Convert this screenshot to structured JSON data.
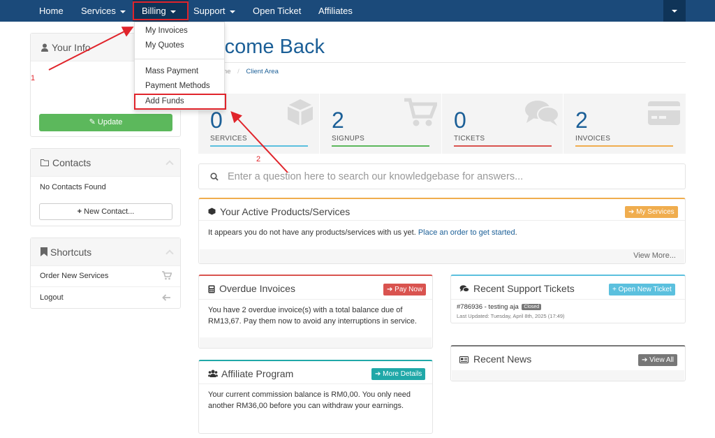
{
  "nav": {
    "items": [
      {
        "label": "Home"
      },
      {
        "label": "Services"
      },
      {
        "label": "Billing"
      },
      {
        "label": "Support"
      },
      {
        "label": "Open Ticket"
      },
      {
        "label": "Affiliates"
      }
    ]
  },
  "billing_dropdown": {
    "items": [
      "My Invoices",
      "My Quotes",
      "Mass Payment",
      "Payment Methods",
      "Add Funds"
    ]
  },
  "annotations": {
    "label1": "1",
    "label2": "2",
    "color": "#e0242b"
  },
  "sidebar": {
    "your_info": {
      "title": "Your Info",
      "update_label": "Update"
    },
    "contacts": {
      "title": "Contacts",
      "empty_text": "No Contacts Found",
      "new_contact_label": "New Contact..."
    },
    "shortcuts": {
      "title": "Shortcuts",
      "items": [
        {
          "label": "Order New Services"
        },
        {
          "label": "Logout"
        }
      ]
    }
  },
  "main": {
    "heading": "elcome Back",
    "breadcrumb": {
      "home": "ome",
      "separator": "/",
      "current": "Client Area"
    },
    "stats": [
      {
        "value": "0",
        "label": "SERVICES",
        "color": "#5bc0de"
      },
      {
        "value": "2",
        "label": "SIGNUPS",
        "color": "#5cb85c"
      },
      {
        "value": "0",
        "label": "TICKETS",
        "color": "#d9534f"
      },
      {
        "value": "2",
        "label": "INVOICES",
        "color": "#f0ad4e"
      }
    ],
    "kb_search_placeholder": "Enter a question here to search our knowledgebase for answers...",
    "active_products": {
      "title": "Your Active Products/Services",
      "button": "My Services",
      "text_prefix": "It appears you do not have any products/services with us yet.",
      "link": "Place an order to get started",
      "text_suffix": ".",
      "view_more": "View More..."
    },
    "overdue_invoices": {
      "title": "Overdue Invoices",
      "button": "Pay Now",
      "text": "You have 2 overdue invoice(s) with a total balance due of RM13,67. Pay them now to avoid any interruptions in service."
    },
    "affiliate": {
      "title": "Affiliate Program",
      "button": "More Details",
      "text": "Your current commission balance is RM0,00. You only need another RM36,00 before you can withdraw your earnings."
    },
    "support_tickets": {
      "title": "Recent Support Tickets",
      "button": "Open New Ticket",
      "ticket_subject": "#786936 - testing aja",
      "ticket_status": "Closed",
      "ticket_updated": "Last Updated: Tuesday, April 8th, 2025 (17:49)"
    },
    "recent_news": {
      "title": "Recent News",
      "button": "View All"
    }
  },
  "colors": {
    "brand": "#1b4a7a",
    "accent": "#1b5f97",
    "danger": "#d9534f",
    "warning": "#f0ad4e",
    "info": "#5bc0de",
    "success": "#5cb85c",
    "teal": "#20a8a8"
  }
}
